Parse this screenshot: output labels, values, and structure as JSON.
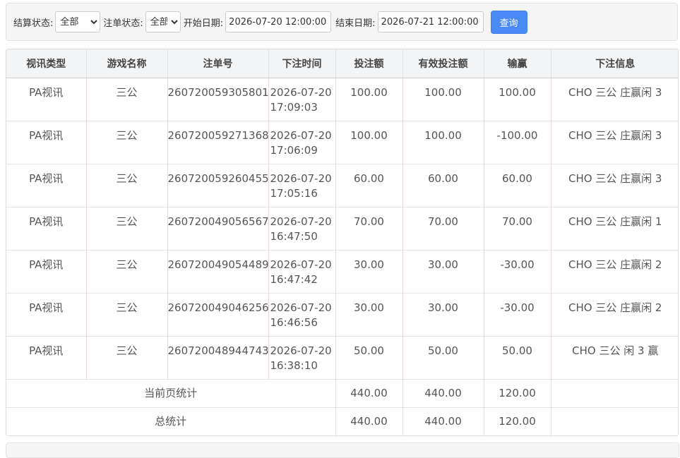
{
  "filters": {
    "settle_label": "结算状态:",
    "settle_value": "全部",
    "bet_label": "注单状态:",
    "bet_value": "全部",
    "start_label": "开始日期:",
    "start_value": "2026-07-20 12:00:00",
    "end_label": "结束日期:",
    "end_value": "2026-07-21 12:00:00",
    "query_label": "查询"
  },
  "table": {
    "headers": [
      "视讯类型",
      "游戏名称",
      "注单号",
      "下注时间",
      "投注额",
      "有效投注额",
      "输赢",
      "下注信息"
    ],
    "rows": [
      {
        "type": "PA视讯",
        "game": "三公",
        "id": "260720059305801",
        "date": "2026-07-20",
        "time": "17:09:03",
        "bet": "100.00",
        "valid": "100.00",
        "win": "100.00",
        "info": "CHO 三公 庄赢闲 3"
      },
      {
        "type": "PA视讯",
        "game": "三公",
        "id": "260720059271368",
        "date": "2026-07-20",
        "time": "17:06:09",
        "bet": "100.00",
        "valid": "100.00",
        "win": "-100.00",
        "info": "CHO 三公 庄赢闲 3"
      },
      {
        "type": "PA视讯",
        "game": "三公",
        "id": "260720059260455",
        "date": "2026-07-20",
        "time": "17:05:16",
        "bet": "60.00",
        "valid": "60.00",
        "win": "60.00",
        "info": "CHO 三公 庄赢闲 3"
      },
      {
        "type": "PA视讯",
        "game": "三公",
        "id": "260720049056567",
        "date": "2026-07-20",
        "time": "16:47:50",
        "bet": "70.00",
        "valid": "70.00",
        "win": "70.00",
        "info": "CHO 三公 庄赢闲 1"
      },
      {
        "type": "PA视讯",
        "game": "三公",
        "id": "260720049054489",
        "date": "2026-07-20",
        "time": "16:47:42",
        "bet": "30.00",
        "valid": "30.00",
        "win": "-30.00",
        "info": "CHO 三公 庄赢闲 2"
      },
      {
        "type": "PA视讯",
        "game": "三公",
        "id": "260720049046256",
        "date": "2026-07-20",
        "time": "16:46:56",
        "bet": "30.00",
        "valid": "30.00",
        "win": "-30.00",
        "info": "CHO 三公 庄赢闲 2"
      },
      {
        "type": "PA视讯",
        "game": "三公",
        "id": "260720048944743",
        "date": "2026-07-20",
        "time": "16:38:10",
        "bet": "50.00",
        "valid": "50.00",
        "win": "50.00",
        "info": "CHO 三公 闲 3 赢"
      }
    ],
    "page_total": {
      "label": "当前页统计",
      "bet": "440.00",
      "valid": "440.00",
      "win": "120.00"
    },
    "grand_total": {
      "label": "总统计",
      "bet": "440.00",
      "valid": "440.00",
      "win": "120.00"
    }
  }
}
